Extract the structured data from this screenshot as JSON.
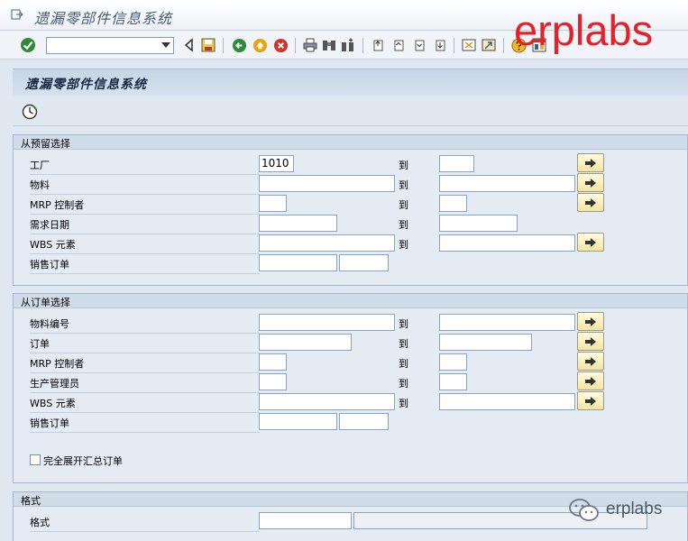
{
  "window": {
    "title": "遗漏零部件信息系统"
  },
  "toolbar": {
    "command_value": ""
  },
  "watermark": {
    "text": "erplabs",
    "color": "#e8202a"
  },
  "screen": {
    "title": "遗漏零部件信息系统"
  },
  "groups": {
    "reservation": {
      "title": "从预留选择",
      "rows": {
        "plant": {
          "label": "工厂",
          "from": "1010",
          "to_label": "到",
          "to": ""
        },
        "material": {
          "label": "物料",
          "from": "",
          "to_label": "到",
          "to": ""
        },
        "mrp": {
          "label": "MRP 控制者",
          "from": "",
          "to_label": "到",
          "to": ""
        },
        "req_date": {
          "label": "需求日期",
          "from": "",
          "to_label": "到",
          "to": ""
        },
        "wbs": {
          "label": "WBS 元素",
          "from": "",
          "to_label": "到",
          "to": ""
        },
        "sales": {
          "label": "销售订单",
          "from": "",
          "item": ""
        }
      }
    },
    "order": {
      "title": "从订单选择",
      "rows": {
        "material_no": {
          "label": "物料编号",
          "from": "",
          "to_label": "到",
          "to": ""
        },
        "order": {
          "label": "订单",
          "from": "",
          "to_label": "到",
          "to": ""
        },
        "mrp": {
          "label": "MRP 控制者",
          "from": "",
          "to_label": "到",
          "to": ""
        },
        "scheduler": {
          "label": "生产管理员",
          "from": "",
          "to_label": "到",
          "to": ""
        },
        "wbs": {
          "label": "WBS 元素",
          "from": "",
          "to_label": "到",
          "to": ""
        },
        "sales": {
          "label": "销售订单",
          "from": "",
          "item": ""
        }
      },
      "checkbox_label": "完全展开汇总订单",
      "checkbox_checked": false
    },
    "format": {
      "title": "格式",
      "rows": {
        "layout": {
          "label": "格式",
          "value": "",
          "desc": ""
        }
      }
    }
  },
  "wechat": {
    "text": "erplabs"
  }
}
